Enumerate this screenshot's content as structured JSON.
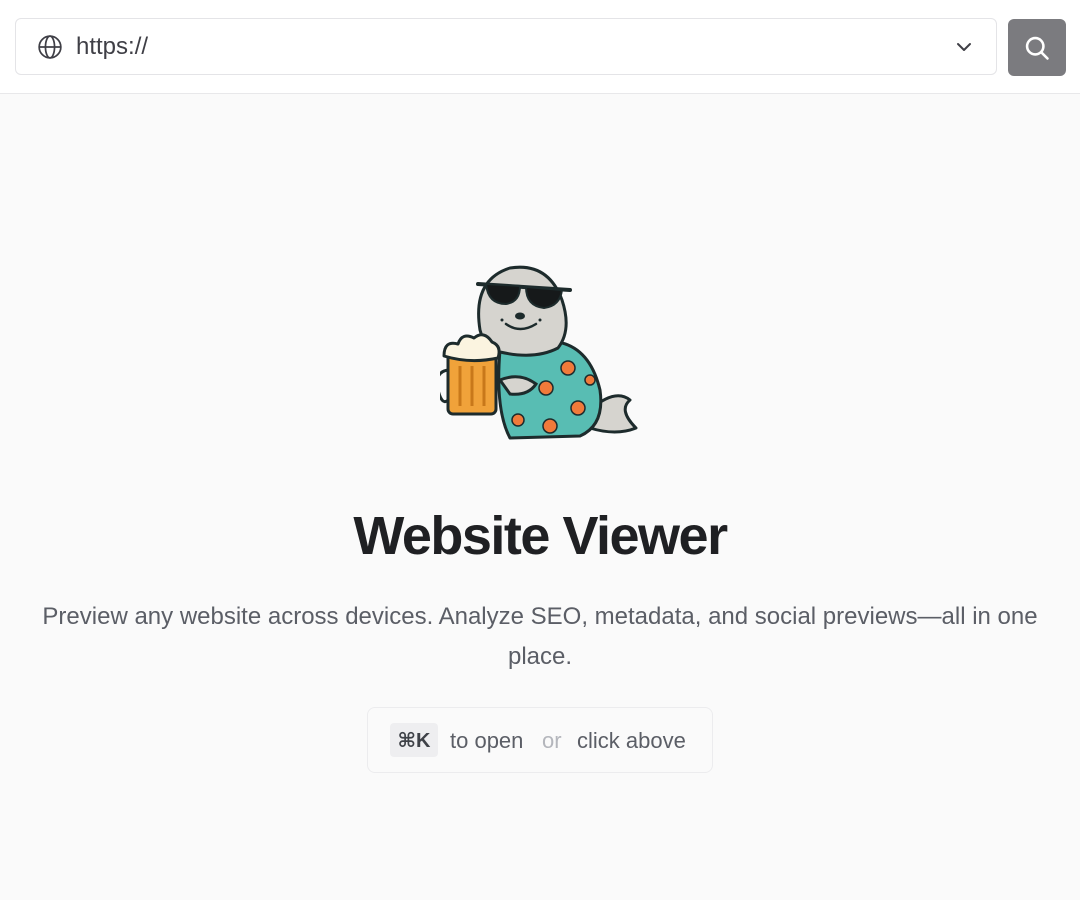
{
  "url_bar": {
    "value": "",
    "placeholder": "https://"
  },
  "icons": {
    "globe": "globe-icon",
    "chevron": "chevron-down-icon",
    "search": "search-icon",
    "mascot": "seal-mascot-illustration"
  },
  "hero": {
    "title": "Website Viewer",
    "subtitle": "Preview any website across devices. Analyze SEO, metadata, and social previews—all in one place."
  },
  "hint": {
    "shortcut": "⌘K",
    "open_text": "to open",
    "or_text": "or",
    "click_text": "click above"
  },
  "colors": {
    "search_button": "#7b7b7f",
    "background": "#fafafa"
  }
}
